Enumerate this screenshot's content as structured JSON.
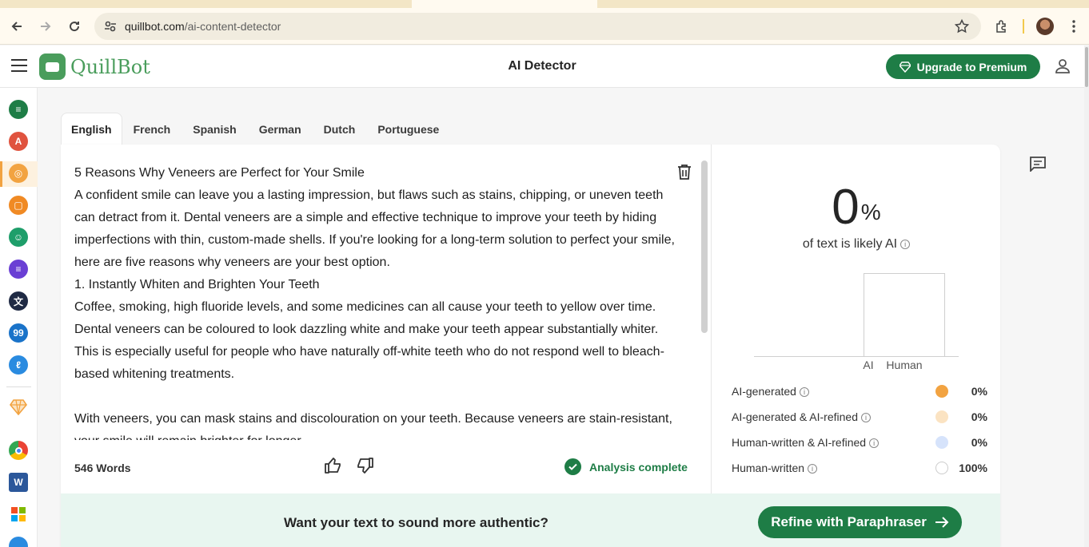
{
  "browser": {
    "url_host": "quillbot.com",
    "url_path": "/ai-content-detector"
  },
  "header": {
    "logo_text": "QuillBot",
    "title": "AI Detector",
    "upgrade_label": "Upgrade to Premium"
  },
  "sidebar": {
    "items": [
      {
        "icon": "paraphraser-icon",
        "color": "#1e7d46"
      },
      {
        "icon": "grammar-checker-icon",
        "color": "#e0533f"
      },
      {
        "icon": "ai-detector-icon",
        "color": "#f2a341"
      },
      {
        "icon": "plagiarism-checker-icon",
        "color": "#f08a24"
      },
      {
        "icon": "ai-humanizer-icon",
        "color": "#1e9e6a"
      },
      {
        "icon": "summarizer-icon",
        "color": "#6a3fd4"
      },
      {
        "icon": "translator-icon",
        "color": "#1f2a44"
      },
      {
        "icon": "citation-generator-icon",
        "color": "#1a73c9"
      },
      {
        "icon": "quillbot-flow-icon",
        "color": "#2a8be0"
      }
    ],
    "premium_icon": "diamond-icon",
    "apps": [
      "chrome-icon",
      "word-icon",
      "windows-icon"
    ]
  },
  "lang_tabs": [
    "English",
    "French",
    "Spanish",
    "German",
    "Dutch",
    "Portuguese"
  ],
  "active_lang": "English",
  "editor": {
    "paragraphs": [
      "5 Reasons Why Veneers are Perfect for Your Smile",
      "A confident smile can leave you a lasting impression, but flaws such as stains, chipping, or uneven teeth can detract from it. Dental veneers are a simple and effective technique to improve your teeth by hiding imperfections with thin, custom-made shells. If you're looking for a long-term solution to perfect your smile, here are five reasons why veneers are your best option.",
      "1. Instantly Whiten and Brighten Your Teeth",
      "Coffee, smoking, high fluoride levels, and some medicines can all cause your teeth to yellow over time. Dental veneers can be coloured to look dazzling white and make your teeth appear substantially whiter. This is especially useful for people who have naturally off-white teeth who do not respond well to bleach-based whitening treatments.",
      "",
      "With veneers, you can mask stains and discolouration on your teeth. Because veneers are stain-resistant, your smile will remain brighter for longer."
    ],
    "word_count": "546 Words",
    "status": "Analysis complete"
  },
  "results": {
    "ai_percent": "0",
    "percent_sign": "%",
    "likely_label": "of text is likely AI",
    "bars": [
      {
        "label": "AI",
        "value": 0
      },
      {
        "label": "Human",
        "value": 100
      }
    ],
    "legend": [
      {
        "label": "AI-generated",
        "value": "0%",
        "color": "#f2a341"
      },
      {
        "label": "AI-generated & AI-refined",
        "value": "0%",
        "color": "#fbe3c2"
      },
      {
        "label": "Human-written & AI-refined",
        "value": "0%",
        "color": "#d6e3fb"
      },
      {
        "label": "Human-written",
        "value": "100%",
        "color": "#ffffff"
      }
    ]
  },
  "banner": {
    "text": "Want your text to sound more authentic?",
    "button_label": "Refine with Paraphraser"
  }
}
